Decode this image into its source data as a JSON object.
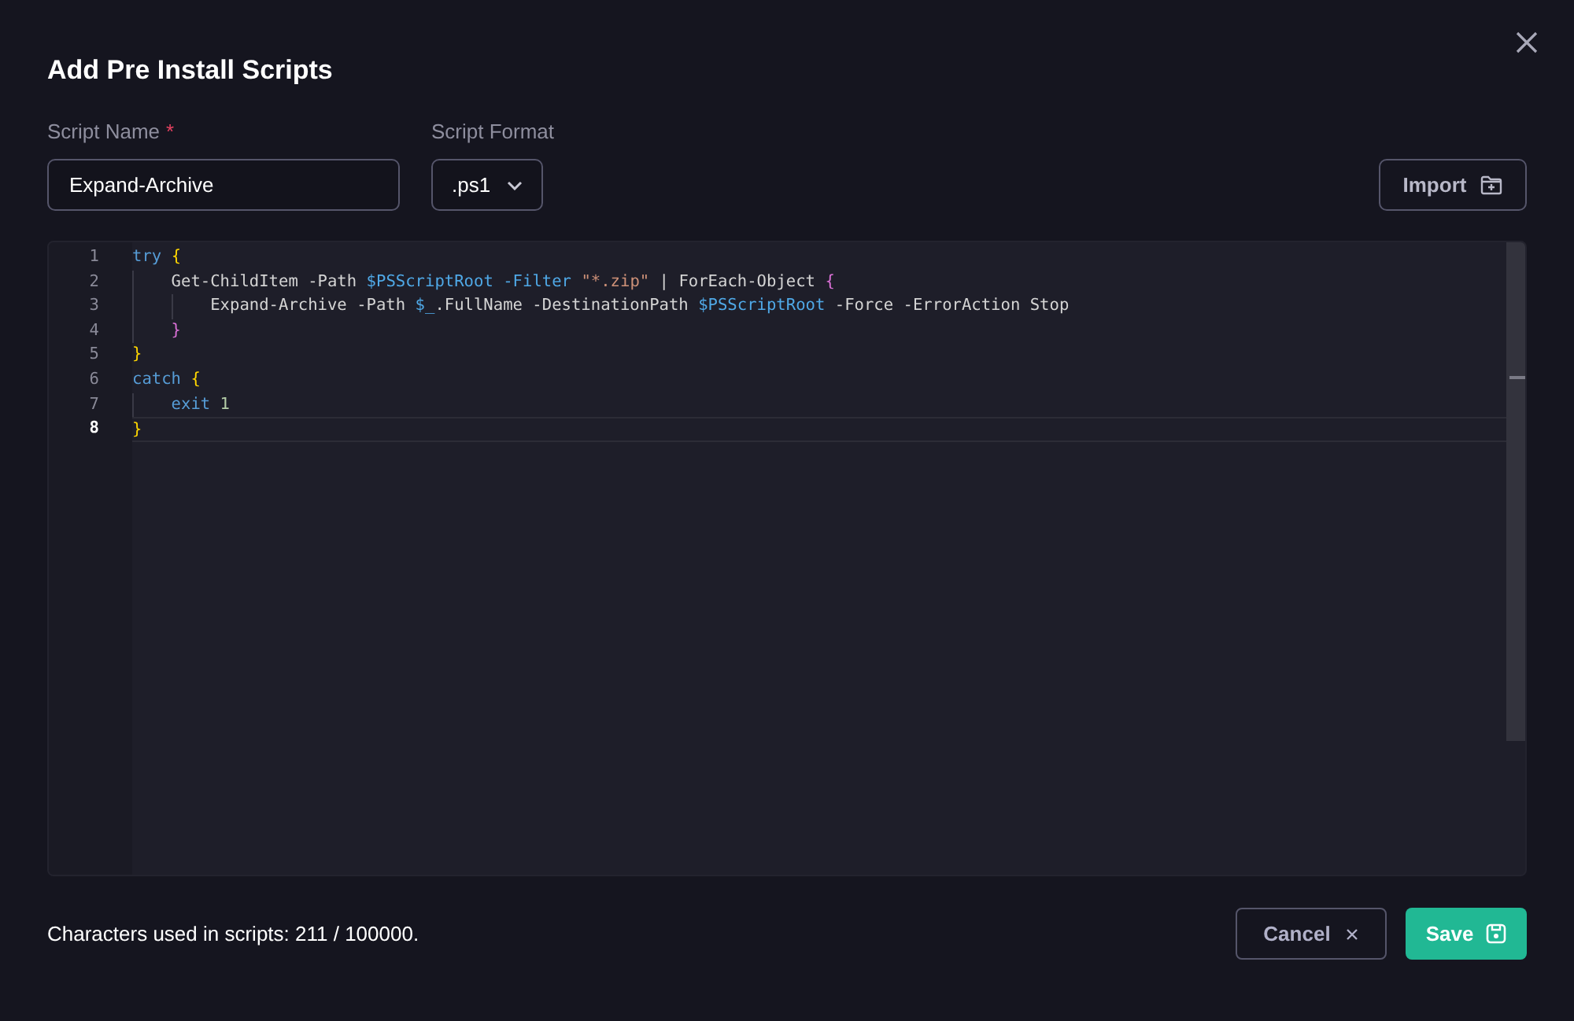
{
  "dialog": {
    "title": "Add Pre Install Scripts"
  },
  "fields": {
    "script_name": {
      "label": "Script Name",
      "required_mark": "*",
      "value": "Expand-Archive"
    },
    "script_format": {
      "label": "Script Format",
      "value": ".ps1"
    }
  },
  "import_button": {
    "label": "Import"
  },
  "editor": {
    "lines": [
      {
        "number": "1",
        "selected": false,
        "tokens": [
          {
            "text": "try ",
            "kind": "keyword"
          },
          {
            "text": "{",
            "kind": "brace1"
          }
        ]
      },
      {
        "number": "2",
        "selected": false,
        "tokens": [
          {
            "text": "    Get-ChildItem -Path ",
            "kind": "plain"
          },
          {
            "text": "$PSScriptRoot ",
            "kind": "variable"
          },
          {
            "text": "-Filter ",
            "kind": "variable"
          },
          {
            "text": "\"*.zip\"",
            "kind": "string"
          },
          {
            "text": " | ForEach-Object ",
            "kind": "plain"
          },
          {
            "text": "{",
            "kind": "brace2"
          }
        ]
      },
      {
        "number": "3",
        "selected": false,
        "tokens": [
          {
            "text": "        Expand-Archive -Path ",
            "kind": "plain"
          },
          {
            "text": "$_",
            "kind": "variable"
          },
          {
            "text": ".FullName -DestinationPath ",
            "kind": "plain"
          },
          {
            "text": "$PSScriptRoot",
            "kind": "variable"
          },
          {
            "text": " -Force -ErrorAction Stop",
            "kind": "plain"
          }
        ]
      },
      {
        "number": "4",
        "selected": false,
        "tokens": [
          {
            "text": "    }",
            "kind": "brace2"
          }
        ]
      },
      {
        "number": "5",
        "selected": false,
        "tokens": [
          {
            "text": "}",
            "kind": "brace1"
          }
        ]
      },
      {
        "number": "6",
        "selected": false,
        "tokens": [
          {
            "text": "catch ",
            "kind": "keyword"
          },
          {
            "text": "{",
            "kind": "brace1"
          }
        ]
      },
      {
        "number": "7",
        "selected": false,
        "tokens": [
          {
            "text": "    exit ",
            "kind": "keyword"
          },
          {
            "text": "1",
            "kind": "number"
          }
        ]
      },
      {
        "number": "8",
        "selected": true,
        "tokens": [
          {
            "text": "}",
            "kind": "brace1"
          }
        ]
      }
    ]
  },
  "footer": {
    "character_count": "Characters used in scripts: 211 / 100000.",
    "cancel_button": {
      "label": "Cancel"
    },
    "save_button": {
      "label": "Save"
    }
  }
}
